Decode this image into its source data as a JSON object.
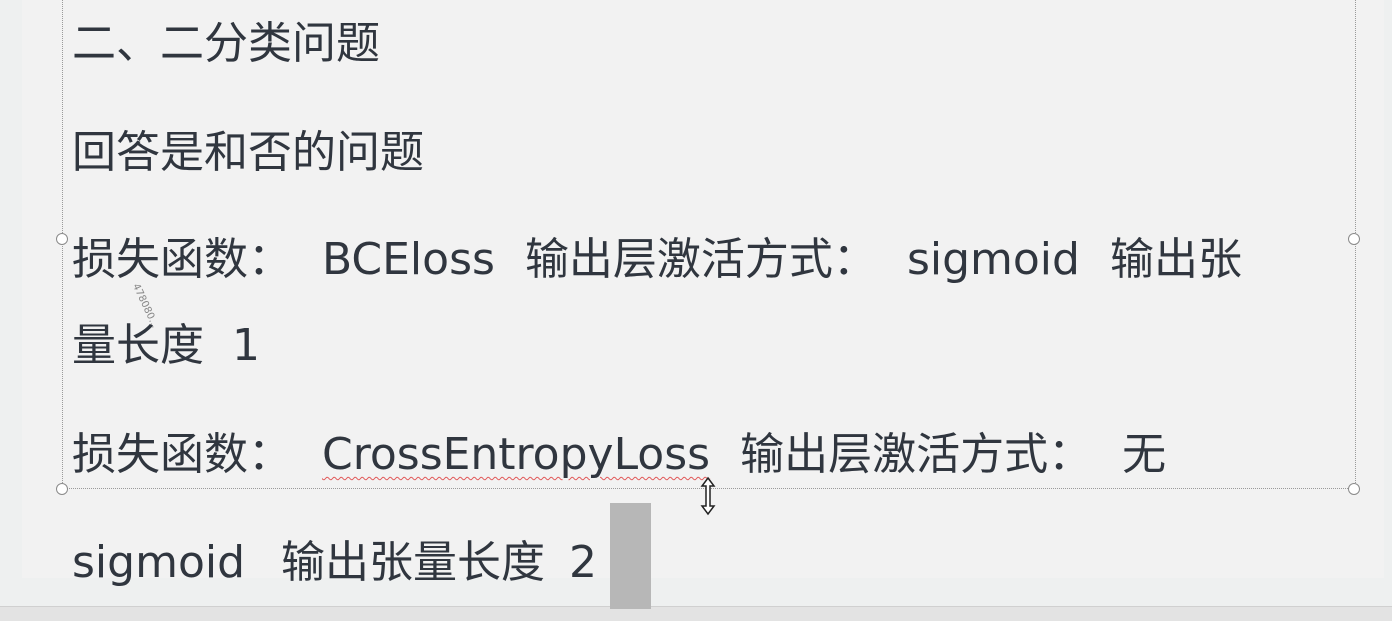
{
  "slide": {
    "heading": "二、二分类问题",
    "subtitle": "回答是和否的问题",
    "line1_a": "损失函数：",
    "line1_b": "BCEloss",
    "line1_c": "输出层激活方式：",
    "line1_d": "sigmoid",
    "line1_e": "输出张",
    "line2": "量长度  1",
    "line3_a": "损失函数：",
    "line3_b": "CrossEntropyLoss",
    "line3_c": "输出层激活方式：",
    "line3_d": "无",
    "line4_a": "sigmoid",
    "line4_b": "输出张量长度",
    "line4_c": "2",
    "watermark": "478080..."
  }
}
